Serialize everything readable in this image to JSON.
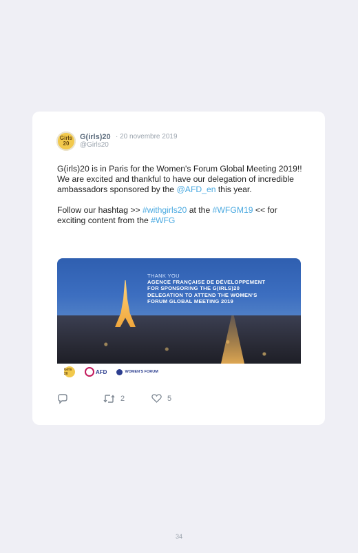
{
  "tweet": {
    "author_name": "G(irls)20",
    "date": "· 20 novembre 2019",
    "handle": "@Girls20",
    "avatar_text": "Girls 20",
    "line1": "G(irls)20 is in Paris for the Women's Forum Global Meeting 2019!!",
    "line2_a": "We are excited and thankful to have our delegation of incredible ambassadors sponsored by the ",
    "mention": "@AFD_en",
    "line2_b": " this year.",
    "line3_a": "Follow our hashtag >> ",
    "hashtag1": "#withgirls20",
    "line3_b": " at the ",
    "hashtag2": "#WFGM19",
    "line3_c": " << for exciting content from the ",
    "hashtag3": "#WFG",
    "media": {
      "thank_you": "THANK YOU",
      "line1": "AGENCE FRANÇAISE DE DÉVELOPPEMENT",
      "line2": "FOR SPONSORING THE G(IRLS)20",
      "line3": "DELEGATION TO ATTEND THE WOMEN'S",
      "line4": "FORUM GLOBAL MEETING 2019",
      "logo_afd": "AFD",
      "logo_wf": "WOMEN'S FORUM",
      "logo_g": "Girls 20"
    },
    "actions": {
      "reply_icon": "reply-icon",
      "retweet_icon": "retweet-icon",
      "retweet_count": "2",
      "like_icon": "heart-icon",
      "like_count": "5"
    }
  },
  "page_number": "34",
  "colors": {
    "link": "#4aa9e0",
    "background": "#efeff5",
    "card": "#ffffff"
  }
}
